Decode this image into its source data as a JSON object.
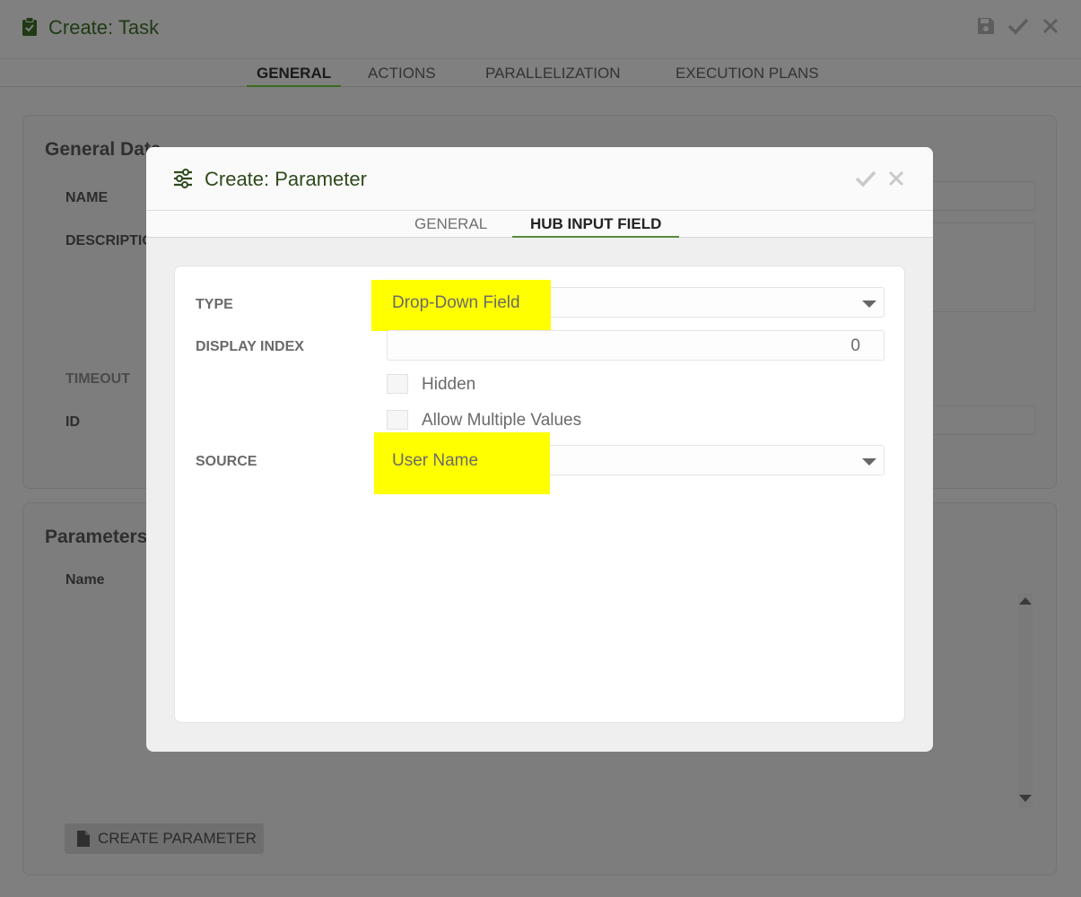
{
  "page": {
    "title": "Create: Task",
    "tabs": [
      "GENERAL",
      "ACTIONS",
      "PARALLELIZATION",
      "EXECUTION PLANS"
    ],
    "active_tab": "GENERAL"
  },
  "general_data": {
    "title": "General Data",
    "labels": {
      "name": "NAME",
      "description": "DESCRIPTION",
      "timeout": "TIMEOUT",
      "id": "ID"
    }
  },
  "parameters": {
    "title": "Parameters",
    "column_name": "Name",
    "create_button": "CREATE PARAMETER"
  },
  "modal": {
    "title": "Create: Parameter",
    "tabs": [
      "GENERAL",
      "HUB INPUT FIELD"
    ],
    "active_tab": "HUB INPUT FIELD",
    "form": {
      "type_label": "TYPE",
      "type_value": "Drop-Down Field",
      "display_index_label": "DISPLAY INDEX",
      "display_index_value": "0",
      "hidden_label": "Hidden",
      "allow_multiple_label": "Allow Multiple Values",
      "source_label": "SOURCE",
      "source_value": "User Name"
    },
    "highlight_color": "#ffff00"
  },
  "colors": {
    "accent": "#3a6b1e",
    "title_green": "#2e4a1c",
    "overlay_gray": "#7f7f7f"
  }
}
